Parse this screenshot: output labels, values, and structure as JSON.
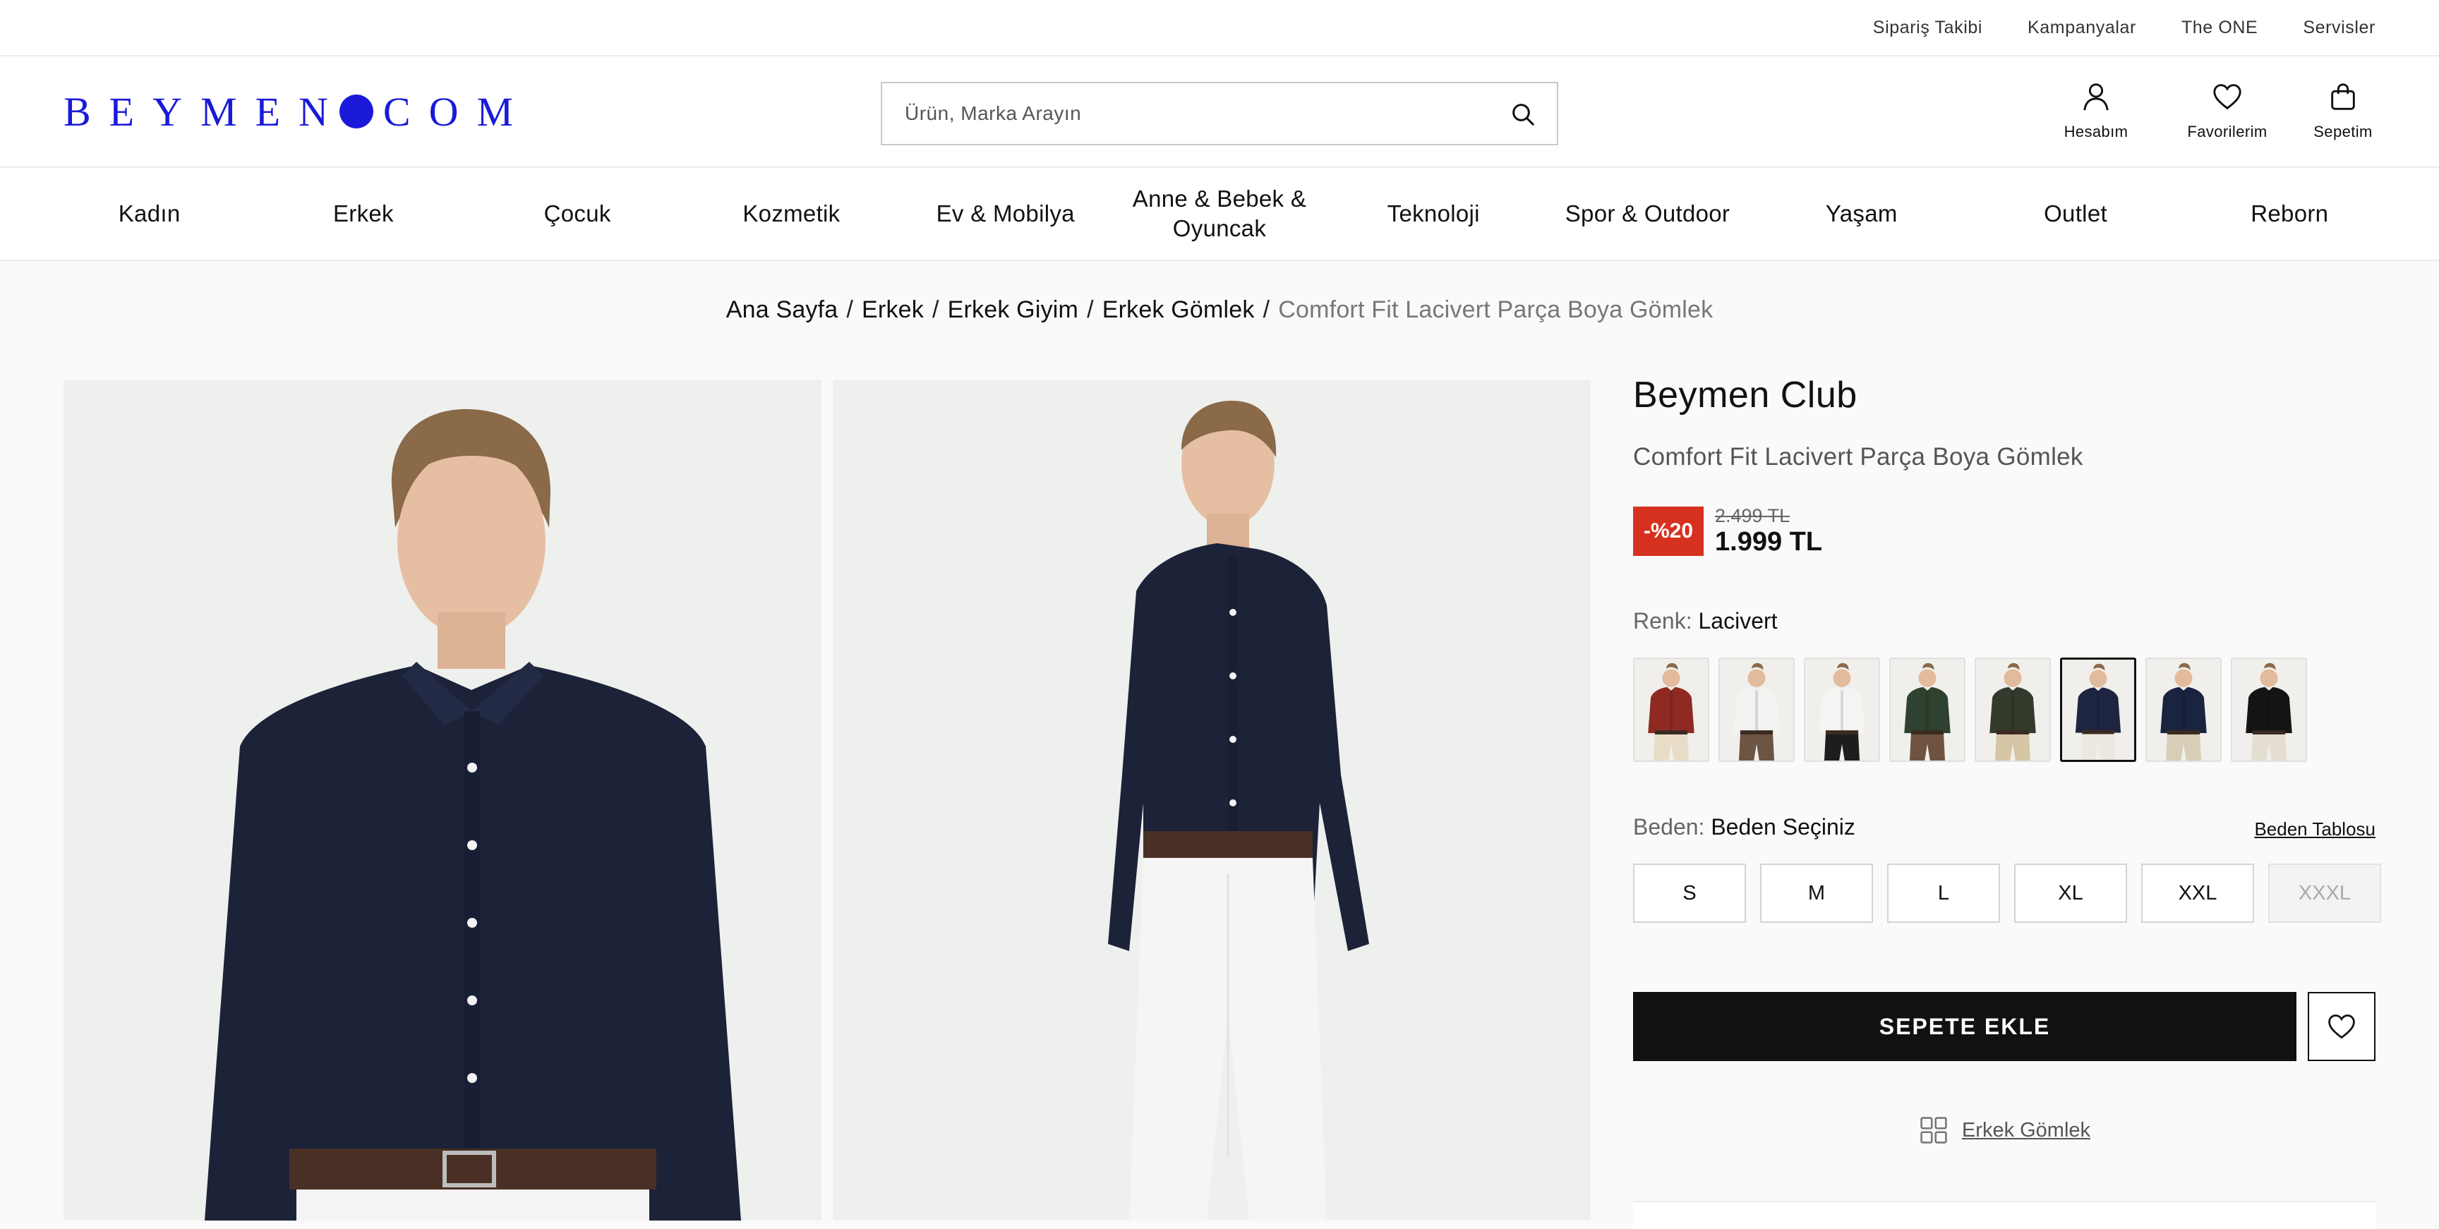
{
  "topbar": {
    "links": [
      "Sipariş Takibi",
      "Kampanyalar",
      "The ONE",
      "Servisler"
    ]
  },
  "header": {
    "logo_left": "BEYMEN",
    "logo_right": "COM",
    "search_placeholder": "Ürün, Marka Arayın",
    "account_label": "Hesabım",
    "favorites_label": "Favorilerim",
    "cart_label": "Sepetim"
  },
  "nav": {
    "items": [
      "Kadın",
      "Erkek",
      "Çocuk",
      "Kozmetik",
      "Ev & Mobilya",
      "Anne & Bebek & Oyuncak",
      "Teknoloji",
      "Spor & Outdoor",
      "Yaşam",
      "Outlet",
      "Reborn"
    ]
  },
  "breadcrumb": {
    "items": [
      "Ana Sayfa",
      "Erkek",
      "Erkek Giyim",
      "Erkek Gömlek"
    ],
    "current": "Comfort Fit Lacivert Parça Boya Gömlek"
  },
  "product": {
    "brand": "Beymen Club",
    "name": "Comfort Fit Lacivert Parça Boya Gömlek",
    "discount": "-%20",
    "old_price": "2.499 TL",
    "price": "1.999 TL",
    "color_label": "Renk:",
    "color_value": "Lacivert",
    "size_label": "Beden:",
    "size_value": "Beden Seçiniz",
    "size_table": "Beden Tablosu",
    "sizes": [
      "S",
      "M",
      "L",
      "XL",
      "XXL",
      "XXXL"
    ],
    "add_to_cart": "SEPETE EKLE",
    "category_link": "Erkek Gömlek"
  },
  "swatch_colors": [
    "#8e2a22",
    "#f2f2f0",
    "#f4f4f2",
    "#2f4230",
    "#333a2c",
    "#1e2540",
    "#1a2340",
    "#141414"
  ],
  "swatch_pants": [
    "#e8dcc6",
    "#6d5543",
    "#1d1d1d",
    "#6e5440",
    "#d6c6a6",
    "#ece8e0",
    "#d8cdb6",
    "#e4ddd2"
  ],
  "colors": {
    "accent_logo": "#1a1ad8",
    "discount_bg": "#d6311f",
    "shirt_navy": "#1c2238"
  }
}
